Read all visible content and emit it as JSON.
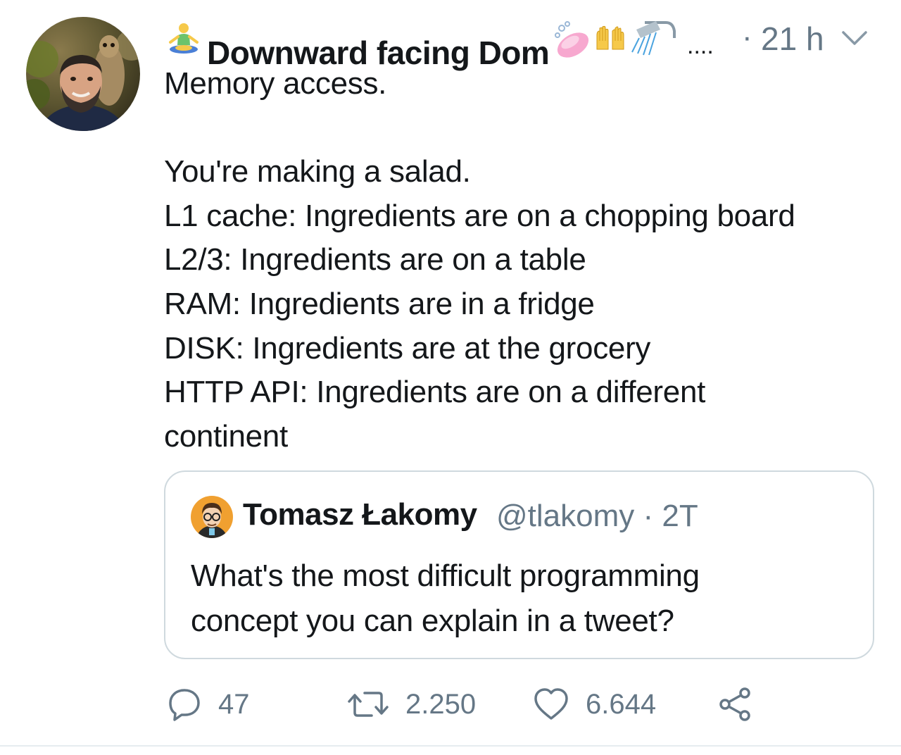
{
  "author": {
    "display_name": "Downward facing Dom",
    "prefix_icon": "person-in-lotus-position-icon",
    "name_emoji_icons": [
      "soap-icon",
      "raising-hands-icon",
      "shower-icon"
    ],
    "overflow": "....",
    "time_separator": "·",
    "time": "21 h",
    "menu_icon": "chevron-down-icon"
  },
  "tweet": {
    "lines": [
      "Memory access.",
      "",
      "You're making a salad.",
      "L1 cache: Ingredients are on a chopping board",
      "L2/3: Ingredients are on a table",
      "RAM: Ingredients are in a fridge",
      "DISK: Ingredients are at the grocery",
      "HTTP API: Ingredients are on a different",
      "continent"
    ]
  },
  "quoted_tweet": {
    "display_name": "Tomasz Łakomy",
    "handle_and_time": "@tlakomy · 2T",
    "lines": [
      "What's the most difficult programming",
      "concept you can explain in a tweet?"
    ]
  },
  "actions": {
    "reply": {
      "icon": "reply-icon",
      "count": "47"
    },
    "retweet": {
      "icon": "retweet-icon",
      "count": "2.250"
    },
    "like": {
      "icon": "heart-icon",
      "count": "6.644"
    },
    "share": {
      "icon": "share-icon"
    }
  },
  "colors": {
    "text": "#14171a",
    "secondary": "#657786",
    "border": "#cfd9de"
  }
}
